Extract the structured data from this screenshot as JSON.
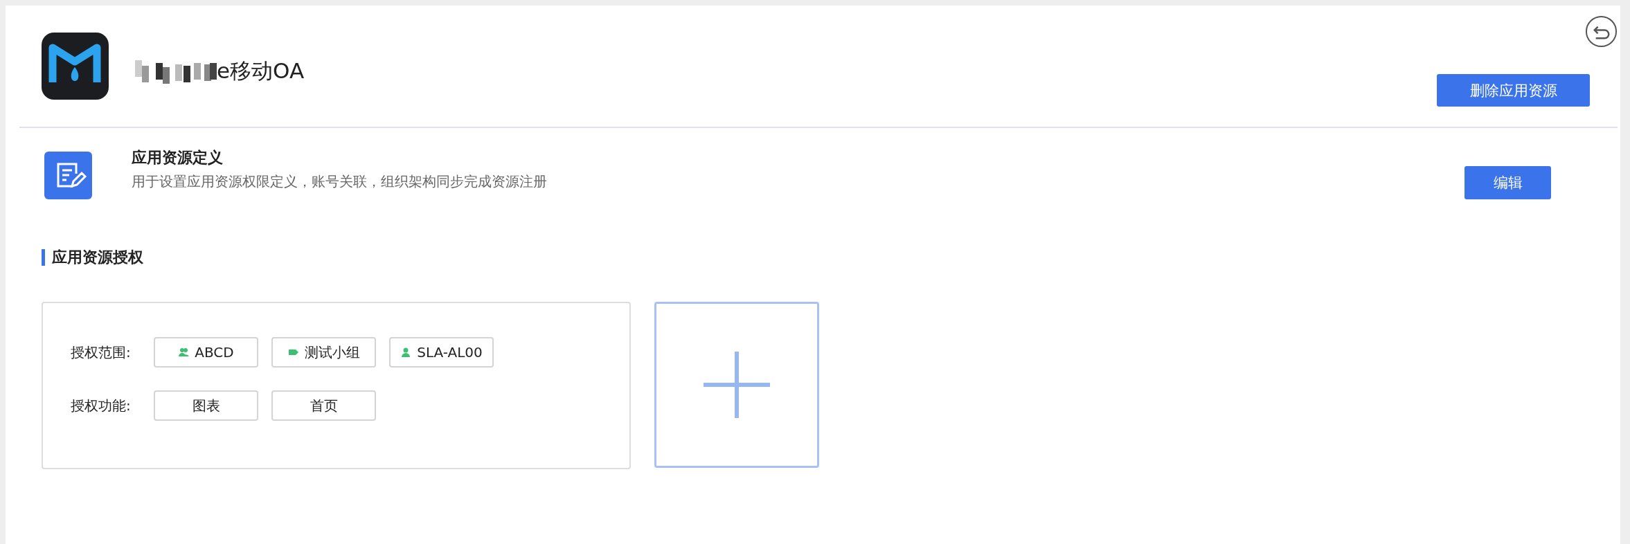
{
  "app": {
    "name": "e移动OA"
  },
  "actions": {
    "delete_button": "删除应用资源"
  },
  "definition": {
    "title": "应用资源定义",
    "description": "用于设置应用资源权限定义，账号关联，组织架构同步完成资源注册",
    "edit_button": "编辑"
  },
  "section": {
    "title": "应用资源授权"
  },
  "grant": {
    "rows": [
      {
        "label": "授权范围:",
        "chips": [
          {
            "kind": "group",
            "text": "ABCD"
          },
          {
            "kind": "tag",
            "text": "测试小组"
          },
          {
            "kind": "user",
            "text": "SLA-AL00"
          }
        ]
      },
      {
        "label": "授权功能:",
        "chips": [
          {
            "kind": "plain",
            "text": "图表"
          },
          {
            "kind": "plain",
            "text": "首页"
          }
        ]
      }
    ]
  }
}
